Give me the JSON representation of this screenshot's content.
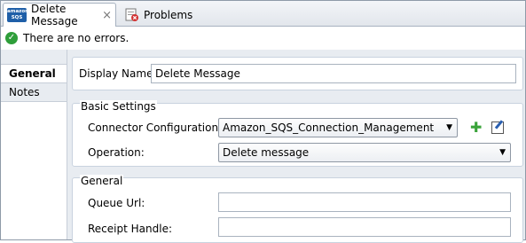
{
  "tabs": [
    {
      "label": "Delete Message",
      "icon": "amazon-sqs-icon",
      "icon_text_top": "amazon",
      "icon_text_bottom": "SQS",
      "close": "×"
    },
    {
      "label": "Problems",
      "icon": "problems-icon"
    }
  ],
  "status": {
    "text": "There are no errors.",
    "icon": "check-icon"
  },
  "nav": [
    {
      "label": "General"
    },
    {
      "label": "Notes"
    }
  ],
  "display_name": {
    "label": "Display Name:",
    "value": "Delete Message"
  },
  "basic_settings": {
    "title": "Basic Settings",
    "connector_label": "Connector Configuration:",
    "connector_value": "Amazon_SQS_Connection_Management",
    "operation_label": "Operation:",
    "operation_value": "Delete message"
  },
  "general": {
    "title": "General",
    "queue_url_label": "Queue Url:",
    "queue_url_value": "",
    "receipt_handle_label": "Receipt Handle:",
    "receipt_handle_value": ""
  },
  "colors": {
    "accent": "#1f5fa8",
    "ok": "#2e9e3a",
    "panel": "#e8ecf1"
  }
}
